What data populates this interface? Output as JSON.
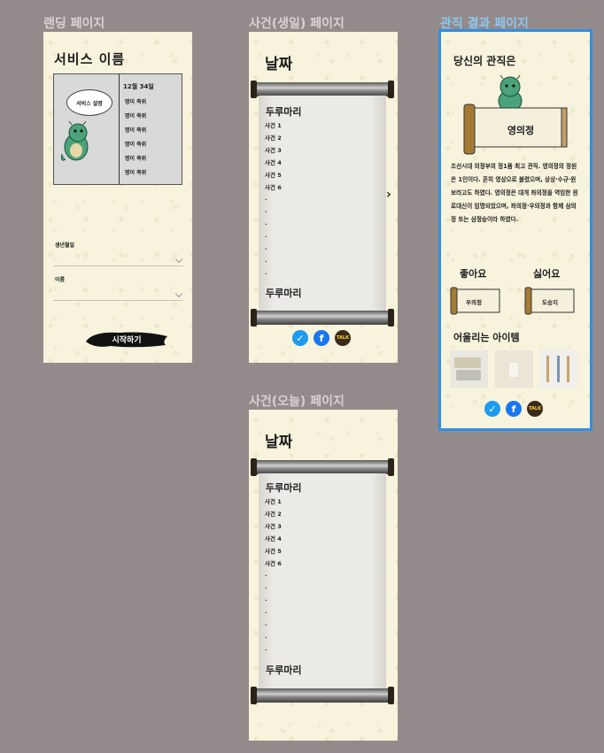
{
  "frames": {
    "landing": {
      "label": "랜딩 페이지",
      "service_name": "서비스 이름",
      "bubble": "서비스 설명",
      "date": "12월 34일",
      "items": [
        "명이 죽위",
        "명이 죽위",
        "명이 죽위",
        "명이 죽위",
        "명이 죽위",
        "명이 죽위"
      ],
      "birthday_label": "생년월일",
      "name_label": "이름",
      "start_button": "시작하기"
    },
    "event_birth": {
      "label": "사건(생일) 페이지",
      "date_title": "날짜",
      "heading_top": "두루마리",
      "events": [
        "사건 1",
        "사건 2",
        "사건 3",
        "사건 4",
        "사건 5",
        "사건 6"
      ],
      "dots": [
        ".",
        ".",
        ".",
        ".",
        ".",
        ".",
        "."
      ],
      "heading_bottom": "두루마리"
    },
    "event_today": {
      "label": "사건(오늘) 페이지",
      "date_title": "날짜",
      "heading_top": "두루마리",
      "events": [
        "사건 1",
        "사건 2",
        "사건 3",
        "사건 4",
        "사건 5",
        "사건 6"
      ],
      "dots": [
        ".",
        ".",
        ".",
        ".",
        ".",
        ".",
        "."
      ],
      "heading_bottom": "두루마리"
    },
    "result": {
      "label": "관직 결과 페이지",
      "title": "당신의 관직은",
      "position": "영의정",
      "description": "조선시대 의정부의 정1품 최고 관직. 영의정의 정원은 1인이다. 흔히 영상으로 불렸으며, 상상·수규·원보라고도 하였다. 영의정은 대개 좌의정을 역임한 원로대신이 임명되었으며, 좌의정·우의정과 함께 삼의정 또는 삼정승이라 하였다.",
      "good_label": "좋아요",
      "bad_label": "싫어요",
      "good_scroll": "우의정",
      "bad_scroll": "도승지",
      "items_title": "어울리는 아이템"
    }
  },
  "share": {
    "talk": "TALK"
  },
  "colors": {
    "selected": "#2e8fe6",
    "dragon": "#4aa37a",
    "paper": "#f7f3dc"
  }
}
